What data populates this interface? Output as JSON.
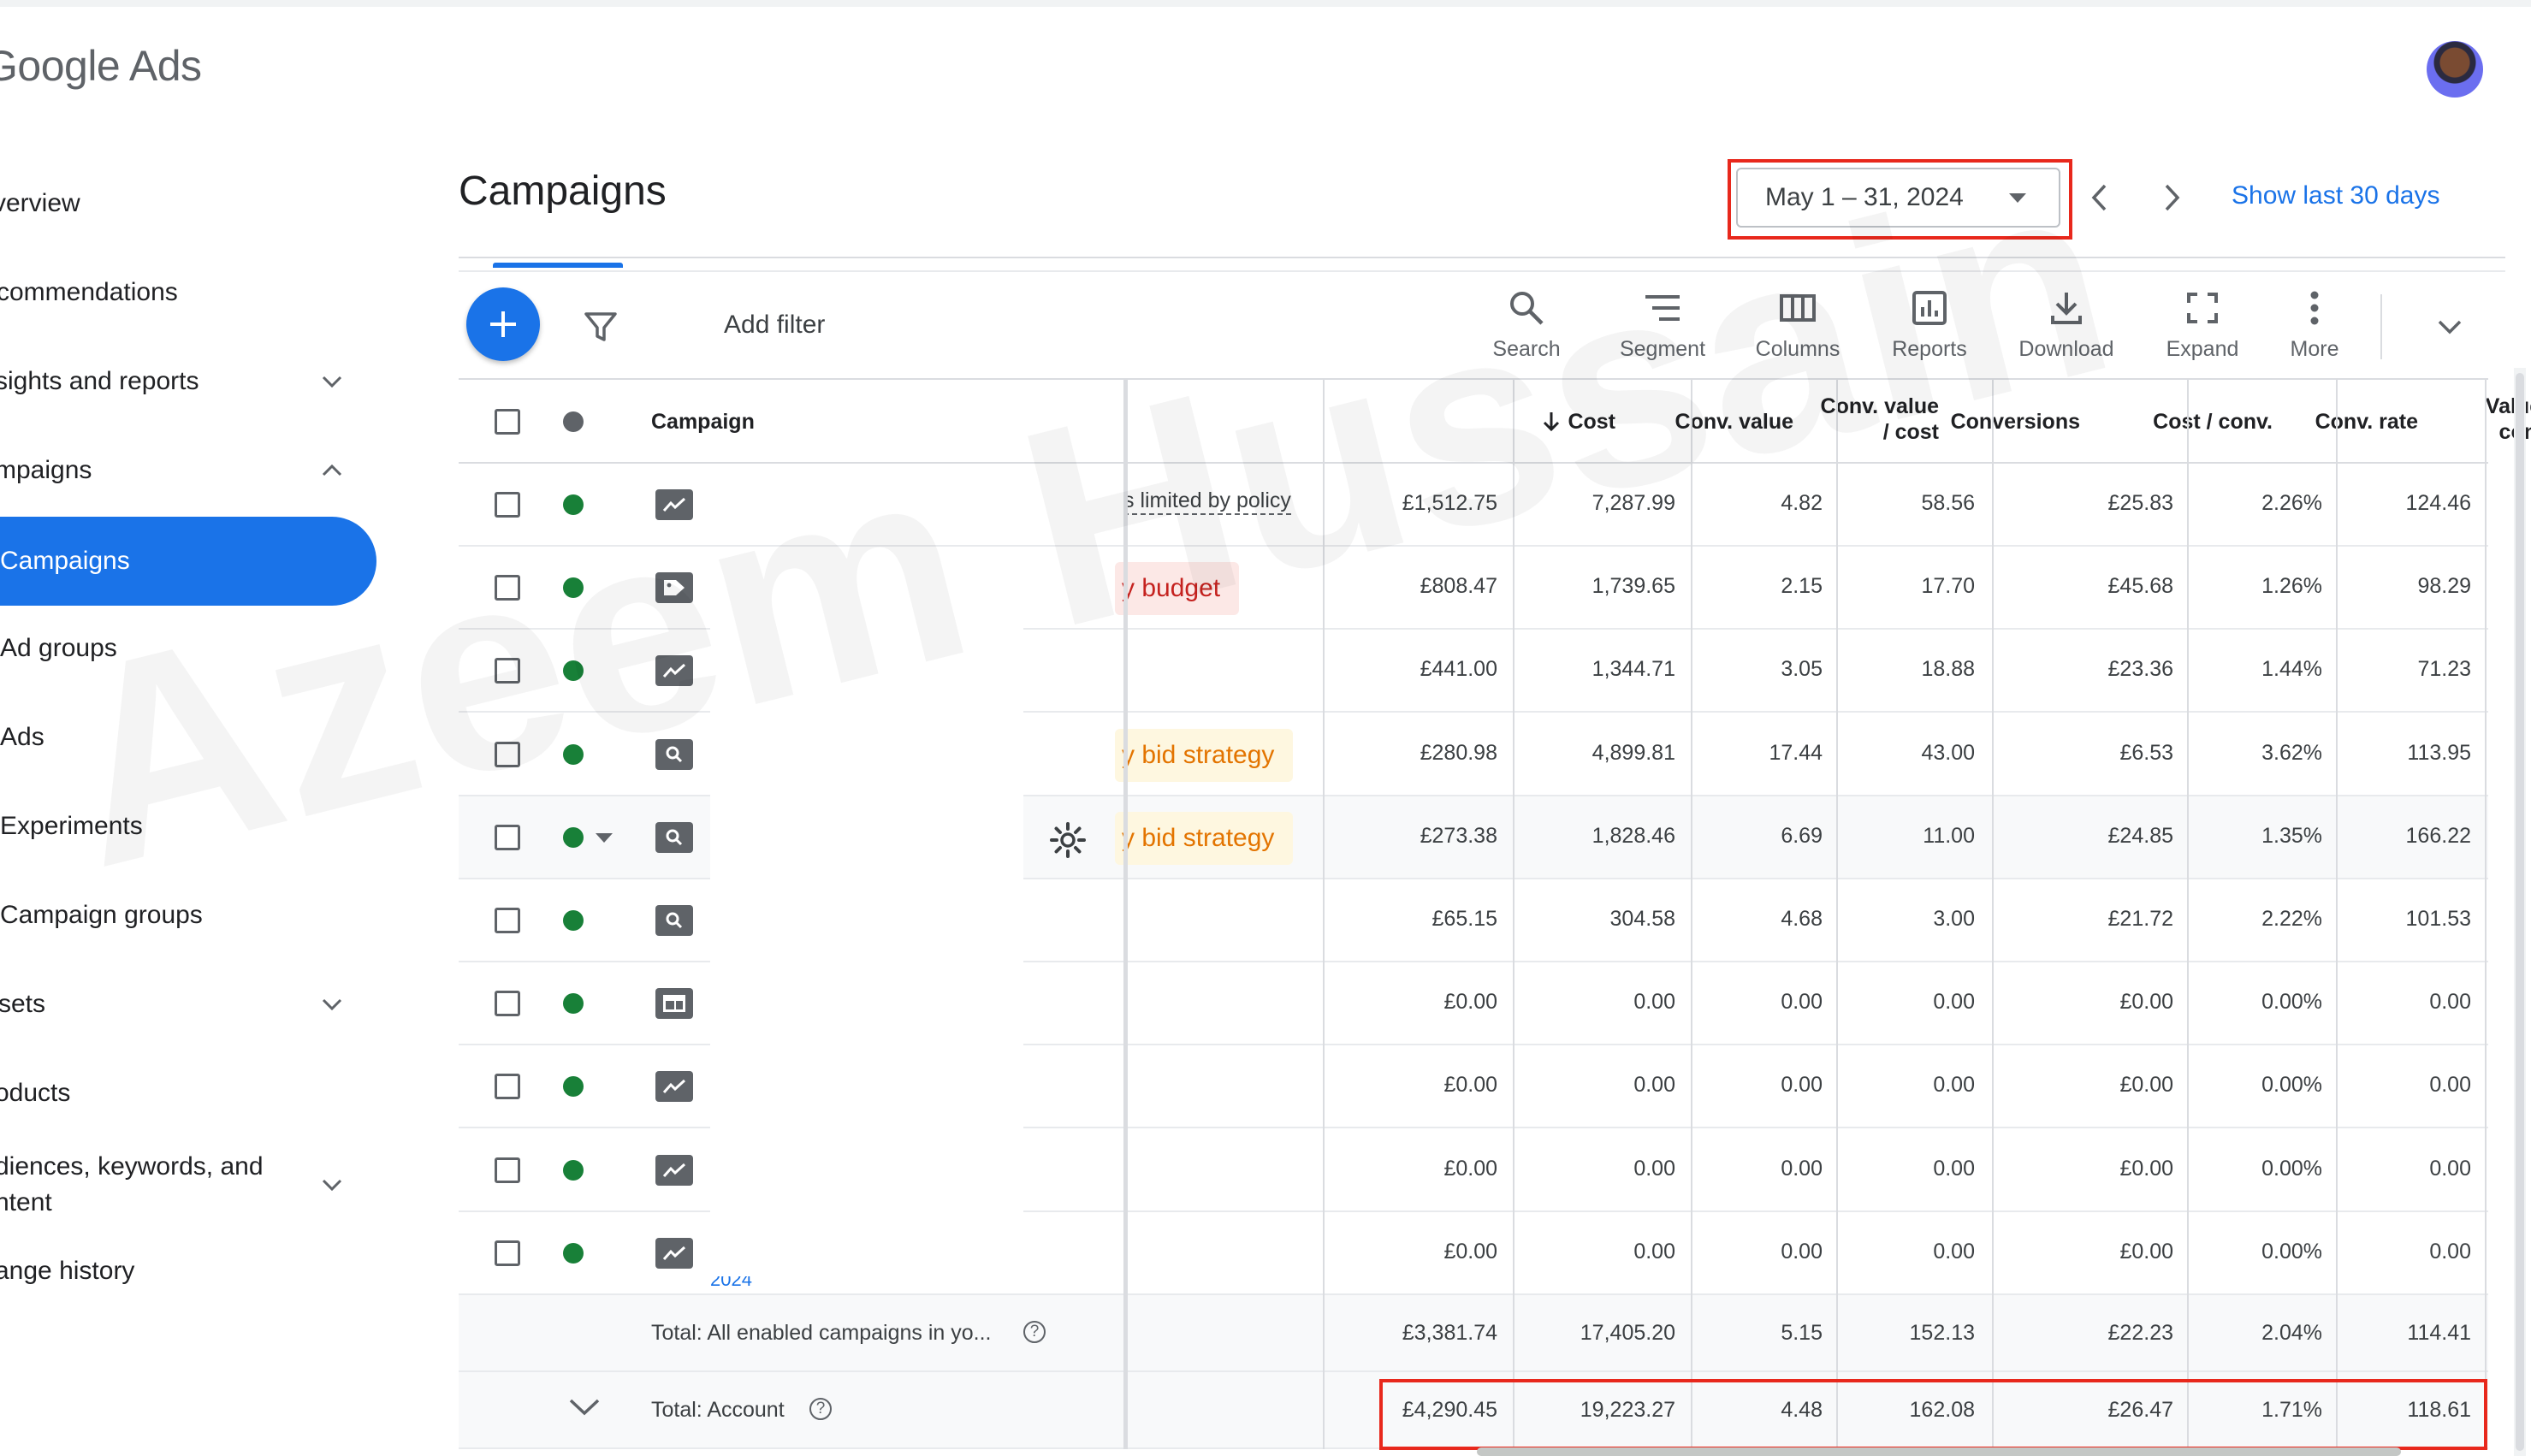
{
  "app": {
    "logo": "Google Ads"
  },
  "sidebar": {
    "items": [
      {
        "label": "verview"
      },
      {
        "label": "commendations"
      },
      {
        "label": "sights and reports"
      },
      {
        "label": "mpaigns"
      },
      {
        "label": "Campaigns"
      },
      {
        "label": "Ad groups"
      },
      {
        "label": "Ads"
      },
      {
        "label": "Experiments"
      },
      {
        "label": "Campaign groups"
      },
      {
        "label": "sets"
      },
      {
        "label": "oducts"
      },
      {
        "label": "diences, keywords, and ntent"
      },
      {
        "label": "ange history"
      }
    ]
  },
  "header": {
    "title": "Campaigns",
    "date_range": "May 1 – 31, 2024",
    "show_last": "Show last 30 days"
  },
  "toolbar": {
    "add_filter": "Add filter",
    "tools": [
      {
        "label": "Search",
        "icon": "search-icon"
      },
      {
        "label": "Segment",
        "icon": "segment-icon"
      },
      {
        "label": "Columns",
        "icon": "columns-icon"
      },
      {
        "label": "Reports",
        "icon": "reports-icon"
      },
      {
        "label": "Download",
        "icon": "download-icon"
      },
      {
        "label": "Expand",
        "icon": "expand-icon"
      },
      {
        "label": "More",
        "icon": "more-vert-icon"
      }
    ]
  },
  "table": {
    "columns": {
      "campaign": "Campaign",
      "cost": "Cost",
      "conv_value": "Conv. value",
      "conv_value_cost_1": "Conv. value",
      "conv_value_cost_2": "/ cost",
      "conversions": "Conversions",
      "cost_conv": "Cost / conv.",
      "conv_rate": "Conv. rate",
      "value_conv_1": "Value /",
      "value_conv_2": "conv."
    },
    "rows": [
      {
        "type_icon": "performance-max-icon",
        "status": "s limited by policy",
        "cost": "£1,512.75",
        "conv_value": "7,287.99",
        "value_cost": "4.82",
        "conversions": "58.56",
        "cost_conv": "£25.83",
        "conv_rate": "2.26%",
        "value_conv": "124.46"
      },
      {
        "type_icon": "shopping-tag-icon",
        "status": "y budget",
        "cost": "£808.47",
        "conv_value": "1,739.65",
        "value_cost": "2.15",
        "conversions": "17.70",
        "cost_conv": "£45.68",
        "conv_rate": "1.26%",
        "value_conv": "98.29"
      },
      {
        "type_icon": "performance-max-icon",
        "status": "",
        "cost": "£441.00",
        "conv_value": "1,344.71",
        "value_cost": "3.05",
        "conversions": "18.88",
        "cost_conv": "£23.36",
        "conv_rate": "1.44%",
        "value_conv": "71.23"
      },
      {
        "type_icon": "search-campaign-icon",
        "status": "y bid strategy",
        "cost": "£280.98",
        "conv_value": "4,899.81",
        "value_cost": "17.44",
        "conversions": "43.00",
        "cost_conv": "£6.53",
        "conv_rate": "3.62%",
        "value_conv": "113.95"
      },
      {
        "type_icon": "search-campaign-icon",
        "status": "y bid strategy",
        "cost": "£273.38",
        "conv_value": "1,828.46",
        "value_cost": "6.69",
        "conversions": "11.00",
        "cost_conv": "£24.85",
        "conv_rate": "1.35%",
        "value_conv": "166.22"
      },
      {
        "type_icon": "search-campaign-icon",
        "status": "",
        "cost": "£65.15",
        "conv_value": "304.58",
        "value_cost": "4.68",
        "conversions": "3.00",
        "cost_conv": "£21.72",
        "conv_rate": "2.22%",
        "value_conv": "101.53"
      },
      {
        "type_icon": "display-campaign-icon",
        "status": "",
        "cost": "£0.00",
        "conv_value": "0.00",
        "value_cost": "0.00",
        "conversions": "0.00",
        "cost_conv": "£0.00",
        "conv_rate": "0.00%",
        "value_conv": "0.00"
      },
      {
        "type_icon": "performance-max-icon",
        "status": "",
        "cost": "£0.00",
        "conv_value": "0.00",
        "value_cost": "0.00",
        "conversions": "0.00",
        "cost_conv": "£0.00",
        "conv_rate": "0.00%",
        "value_conv": "0.00"
      },
      {
        "type_icon": "performance-max-icon",
        "status": "",
        "cost": "£0.00",
        "conv_value": "0.00",
        "value_cost": "0.00",
        "conversions": "0.00",
        "cost_conv": "£0.00",
        "conv_rate": "0.00%",
        "value_conv": "0.00"
      },
      {
        "type_icon": "performance-max-icon",
        "status": "",
        "cost": "£0.00",
        "conv_value": "0.00",
        "value_cost": "0.00",
        "conversions": "0.00",
        "cost_conv": "£0.00",
        "conv_rate": "0.00%",
        "value_conv": "0.00"
      }
    ],
    "totals": [
      {
        "label": "Total: All enabled campaigns in yo...",
        "cost": "£3,381.74",
        "conv_value": "17,405.20",
        "value_cost": "5.15",
        "conversions": "152.13",
        "cost_conv": "£22.23",
        "conv_rate": "2.04%",
        "value_conv": "114.41"
      },
      {
        "label": "Total: Account",
        "cost": "£4,290.45",
        "conv_value": "19,223.27",
        "value_cost": "4.48",
        "conversions": "162.08",
        "cost_conv": "£26.47",
        "conv_rate": "1.71%",
        "value_conv": "118.61"
      }
    ]
  },
  "watermark": "Azeem Hussain",
  "colors": {
    "accent": "#1a73e8",
    "enabled_dot": "#188038",
    "highlight_box": "#e8281c",
    "budget_chip_bg": "#fce8e6",
    "budget_chip_text": "#c5221f",
    "bid_chip_bg": "#fef7e0",
    "bid_chip_text": "#e37400"
  }
}
